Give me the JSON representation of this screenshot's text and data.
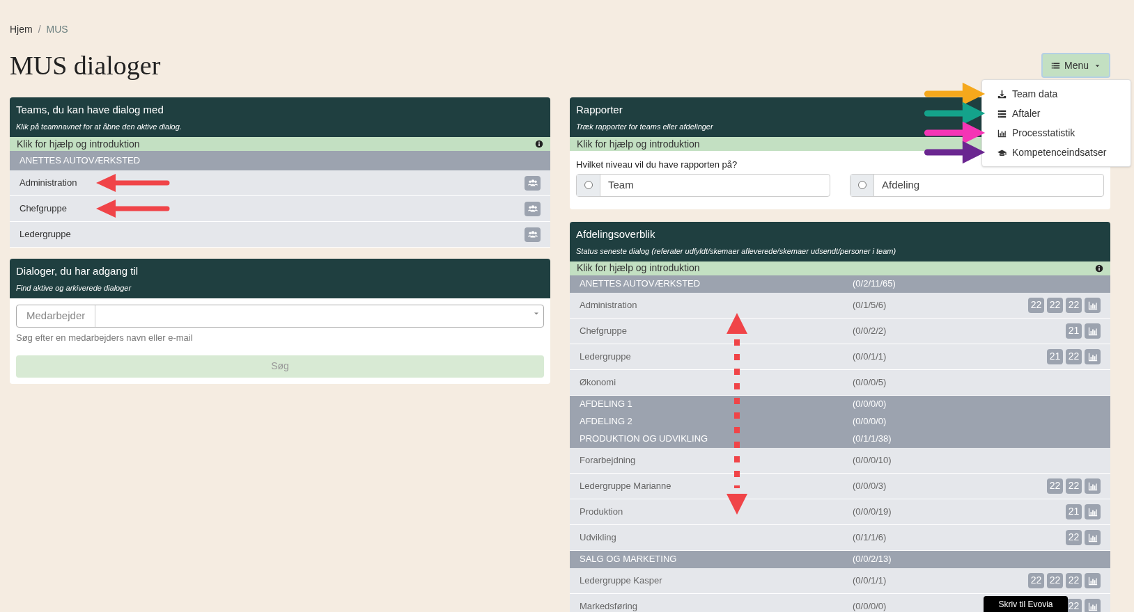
{
  "breadcrumb": {
    "separator": "/",
    "items": [
      {
        "label": "Hjem",
        "selected": false
      },
      {
        "label": "MUS",
        "selected": true
      }
    ]
  },
  "title": "MUS dialoger",
  "menu": {
    "label": "Menu",
    "items": [
      {
        "label": "Team data",
        "color": "#f5a81c"
      },
      {
        "label": "Aftaler",
        "color": "#14a38b"
      },
      {
        "label": "Processtatistik",
        "color": "#f535b5"
      },
      {
        "label": "Kompetenceindsatser",
        "color": "#6a2690"
      }
    ]
  },
  "teams_panel": {
    "title": "Teams, du kan have dialog med",
    "subtitle": "Klik på teamnavnet for at åbne den aktive dialog.",
    "help": "Klik for hjælp og introduktion",
    "groups": [
      {
        "name": "ANETTES AUTOVÆRKSTED",
        "teams": [
          {
            "name": "Administration",
            "pointed": true
          },
          {
            "name": "Chefgruppe",
            "pointed": true
          },
          {
            "name": "Ledergruppe",
            "pointed": false
          }
        ]
      }
    ]
  },
  "dialog_panel": {
    "title": "Dialoger, du har adgang til",
    "subtitle": "Find aktive og arkiverede dialoger",
    "field_label": "Medarbejder",
    "hint": "Søg efter en medarbejders navn eller e-mail",
    "button": {
      "label": "Søg",
      "disabled": true
    }
  },
  "reports_panel": {
    "title": "Rapporter",
    "subtitle": "Træk rapporter for teams eller afdelinger",
    "help": "Klik for hjælp og introduktion",
    "question": "Hvilket niveau vil du have rapporten på?",
    "options": [
      {
        "label": "Team",
        "selected": false
      },
      {
        "label": "Afdeling",
        "selected": false
      }
    ]
  },
  "overview": {
    "title": "Afdelingsoverblik",
    "subtitle": "Status seneste dialog (referater udfyldt/skemaer afleverede/skemaer udsendt/personer i team)",
    "help": "Klik for hjælp og introduktion",
    "rows": [
      {
        "kind": "group",
        "name": "ANETTES AUTOVÆRKSTED",
        "status": "(0/2/11/65)"
      },
      {
        "kind": "team",
        "name": "Administration",
        "status": "(0/1/5/6)",
        "badges": [
          "22",
          "22",
          "22"
        ]
      },
      {
        "kind": "team",
        "name": "Chefgruppe",
        "status": "(0/0/2/2)",
        "badges": [
          "21"
        ]
      },
      {
        "kind": "team",
        "name": "Ledergruppe",
        "status": "(0/0/1/1)",
        "badges": [
          "21",
          "22"
        ]
      },
      {
        "kind": "team",
        "name": "Økonomi",
        "status": "(0/0/0/5)"
      },
      {
        "kind": "group",
        "name": "AFDELING 1",
        "status": "(0/0/0/0)"
      },
      {
        "kind": "group",
        "name": "AFDELING 2",
        "status": "(0/0/0/0)"
      },
      {
        "kind": "group",
        "name": "PRODUKTION OG UDVIKLING",
        "status": "(0/1/1/38)"
      },
      {
        "kind": "team",
        "name": "Forarbejdning",
        "status": "(0/0/0/10)"
      },
      {
        "kind": "team",
        "name": "Ledergruppe Marianne",
        "status": "(0/0/0/3)",
        "badges": [
          "22",
          "22"
        ]
      },
      {
        "kind": "team",
        "name": "Produktion",
        "status": "(0/0/0/19)",
        "badges": [
          "21"
        ]
      },
      {
        "kind": "team",
        "name": "Udvikling",
        "status": "(0/1/1/6)",
        "badges": [
          "22"
        ]
      },
      {
        "kind": "group",
        "name": "SALG OG MARKETING",
        "status": "(0/0/2/13)"
      },
      {
        "kind": "team",
        "name": "Ledergruppe Kasper",
        "status": "(0/0/1/1)",
        "badges": [
          "22",
          "22",
          "22"
        ]
      },
      {
        "kind": "team",
        "name": "Markedsføring",
        "status": "(0/0/0/0)",
        "badges": [
          "22"
        ]
      }
    ]
  },
  "chat_button": "Skriv til Evovia"
}
